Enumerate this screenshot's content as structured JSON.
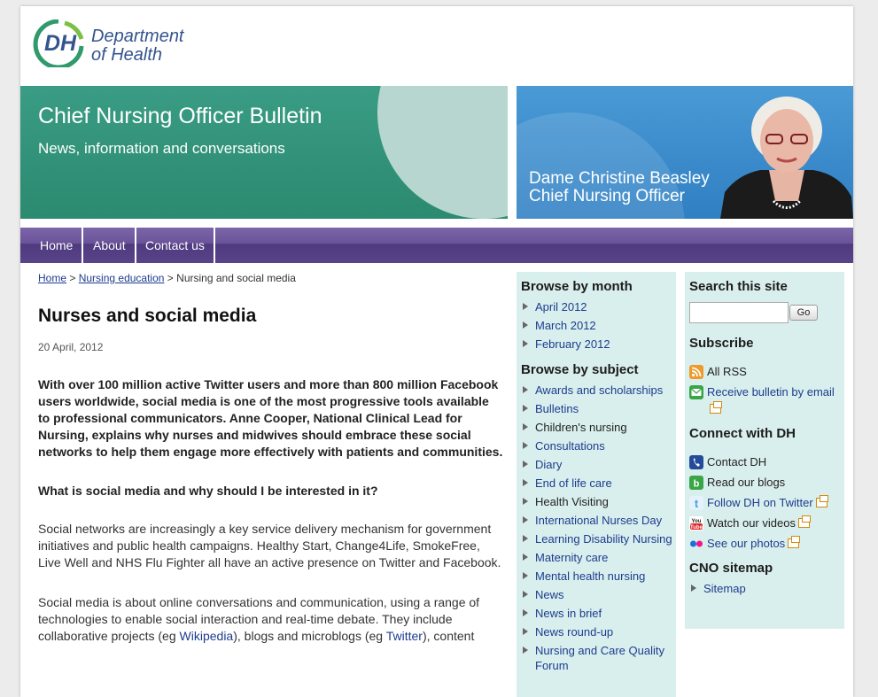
{
  "logo": {
    "mark": "DH",
    "line1": "Department",
    "line2": "of Health"
  },
  "banner": {
    "title": "Chief Nursing Officer Bulletin",
    "subtitle": "News, information and conversations",
    "person_name": "Dame Christine Beasley",
    "person_role": "Chief Nursing Officer"
  },
  "nav": {
    "items": [
      "Home",
      "About",
      "Contact us"
    ]
  },
  "breadcrumb": {
    "home": "Home",
    "sep": ">",
    "parent": "Nursing education",
    "current": "Nursing and social media"
  },
  "article": {
    "title": "Nurses and social media",
    "date": "20 April, 2012",
    "lead": "With over 100 million active Twitter users and more than 800 million Facebook users worldwide, social media is one of the most progressive tools available to professional communicators. Anne Cooper, National Clinical Lead for Nursing, explains why nurses and midwives should embrace these social networks to help them engage more effectively with patients and communities.",
    "question": "What is social media and why should I be interested in it?",
    "para1": "Social networks are increasingly a key service delivery mechanism for government initiatives and public health campaigns. Healthy Start, Change4Life, SmokeFree, Live Well and NHS Flu Fighter all have an active presence on Twitter and Facebook.",
    "para2_a": "Social media is about online conversations and communication, using a range of technologies to enable social interaction and real-time debate.  They include collaborative projects (eg ",
    "para2_link1": "Wikipedia",
    "para2_b": "), blogs and microblogs (eg ",
    "para2_link2": "Twitter",
    "para2_c": "), content"
  },
  "browse_month": {
    "heading": "Browse by month",
    "items": [
      "April 2012",
      "March 2012",
      "February 2012"
    ]
  },
  "browse_subject": {
    "heading": "Browse by subject",
    "items": [
      "Awards and scholarships",
      "Bulletins",
      "Children's nursing",
      "Consultations",
      "Diary",
      "End of life care",
      "Health Visiting",
      "International Nurses Day",
      "Learning Disability Nursing",
      "Maternity care",
      "Mental health nursing",
      "News",
      "News in brief",
      "News round-up",
      "Nursing and Care Quality Forum"
    ]
  },
  "search": {
    "heading": "Search this site",
    "placeholder": "",
    "button": "Go"
  },
  "subscribe": {
    "heading": "Subscribe",
    "rss": "All RSS",
    "email": "Receive bulletin by email"
  },
  "connect": {
    "heading": "Connect with DH",
    "items": [
      "Contact DH",
      "Read our blogs",
      "Follow DH on Twitter",
      "Watch our videos",
      "See our photos"
    ]
  },
  "sitemap": {
    "heading": "CNO sitemap",
    "item": "Sitemap"
  },
  "colors": {
    "teal": "#2b8a70",
    "blue": "#2f7fc3",
    "purple": "#5a4388",
    "sidebar": "#d9efed",
    "link": "#1d3c8e"
  }
}
